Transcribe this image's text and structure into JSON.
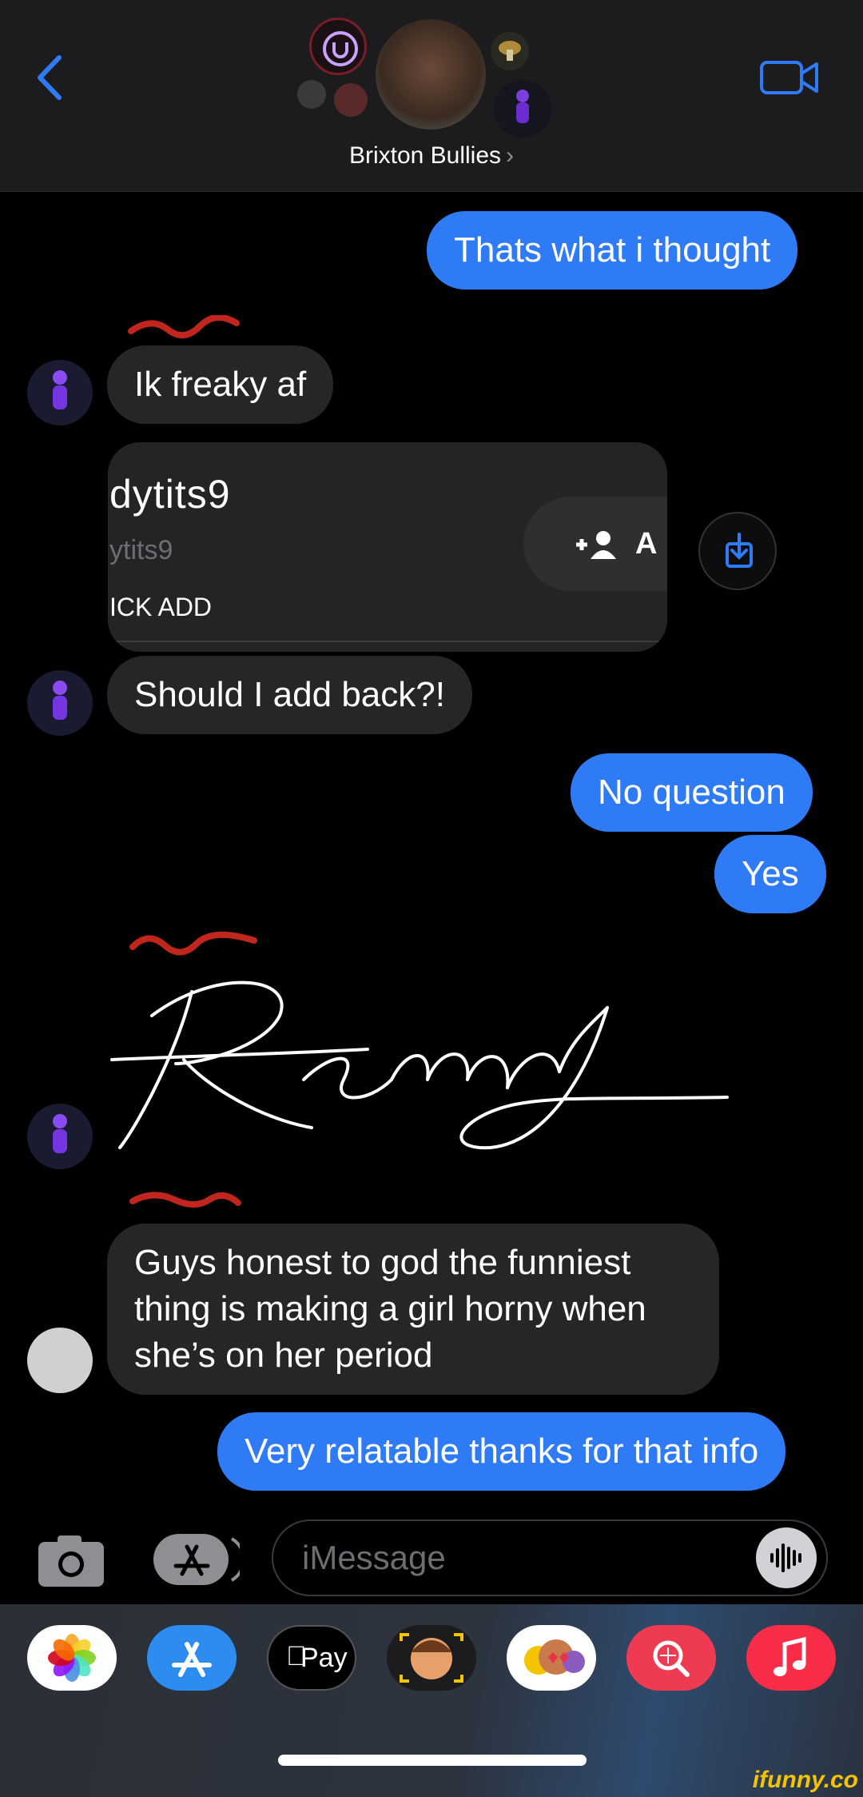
{
  "header": {
    "group_name": "Brixton Bullies",
    "chevron": "›",
    "icons": {
      "back": "chevron-left-icon",
      "video": "video-camera-icon"
    },
    "accent_color": "#2f7bf5"
  },
  "messages": [
    {
      "direction": "outgoing",
      "text": "Thats what i thought"
    },
    {
      "direction": "incoming",
      "text": "Ik freaky af"
    },
    {
      "direction": "incoming",
      "type": "shared-card",
      "username": "dytits9",
      "handle": "ytits9",
      "action": "ICK ADD",
      "button_label": "A"
    },
    {
      "direction": "incoming",
      "text": "Should I add back?!"
    },
    {
      "direction": "outgoing",
      "text": "No question"
    },
    {
      "direction": "outgoing",
      "text": "Yes"
    },
    {
      "direction": "incoming",
      "type": "handwriting",
      "text": "Remy"
    },
    {
      "direction": "incoming",
      "lines": [
        "Guys honest to god the funniest",
        "thing is making a girl horny when",
        "she’s on her period"
      ]
    },
    {
      "direction": "outgoing",
      "text": "Very relatable thanks for that info"
    }
  ],
  "input": {
    "placeholder": "iMessage",
    "icons": {
      "camera": "camera-icon",
      "apps": "app-store-icon",
      "audio": "waveform-icon"
    }
  },
  "app_drawer": {
    "apps": [
      {
        "name": "photos-icon",
        "bg": "#ffffff"
      },
      {
        "name": "app-store-icon",
        "bg": "#2d8cf0"
      },
      {
        "name": "apple-pay-icon",
        "bg": "#000000",
        "label": "Pay"
      },
      {
        "name": "memoji-icon",
        "bg": "#1c1c1e"
      },
      {
        "name": "animoji-icon",
        "bg": "#ffffff"
      },
      {
        "name": "search-images-icon",
        "bg": "#ef3b52"
      },
      {
        "name": "music-icon",
        "bg": "#fa2d48"
      }
    ]
  },
  "watermark": "ifunny.co"
}
